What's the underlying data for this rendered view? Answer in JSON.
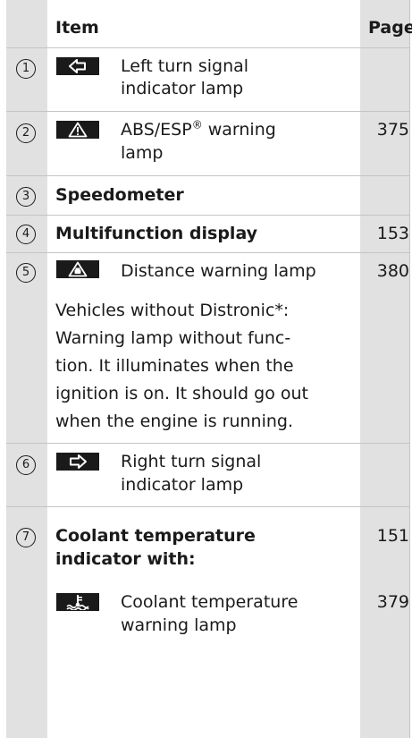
{
  "header": {
    "item": "Item",
    "page": "Page"
  },
  "rows": [
    {
      "num": "1",
      "icon": "left-arrow-icon",
      "text": "Left turn signal indicator lamp",
      "line1": "Left turn signal",
      "line2": "indicator lamp",
      "page": ""
    },
    {
      "num": "2",
      "icon": "warning-triangle-icon",
      "line1_pre": "ABS/ESP",
      "line1_sup": "®",
      "line1_post": " warning",
      "line2": "lamp",
      "page": "375"
    },
    {
      "num": "3",
      "text": "Speedometer",
      "page": ""
    },
    {
      "num": "4",
      "text": "Multifunction display",
      "page": "153"
    },
    {
      "num": "5",
      "icon": "distance-warning-icon",
      "text": "Distance warning lamp",
      "page": "380"
    },
    {
      "num": "6",
      "icon": "right-arrow-icon",
      "line1": "Right turn signal",
      "line2": "indicator lamp",
      "page": ""
    },
    {
      "num": "7",
      "line1": "Coolant temperature",
      "line2": "indicator with:",
      "page": "151"
    }
  ],
  "note": {
    "lines": [
      "Vehicles without Distronic*:",
      "Warning lamp without func-",
      "tion. It illuminates when the",
      "ignition is on. It should go out",
      "when the engine is running."
    ]
  },
  "sub_row": {
    "icon": "coolant-temperature-icon",
    "line1": "Coolant temperature",
    "line2": "warning lamp",
    "page": "379"
  }
}
